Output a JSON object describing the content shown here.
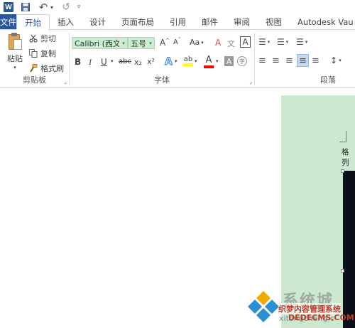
{
  "quick_access": {
    "app_icon_letter": "W",
    "save_glyph": "💾",
    "undo_glyph": "↶",
    "undo_dd": "▾",
    "redo_glyph": "↺",
    "customize_glyph": "▿"
  },
  "tabs": [
    {
      "label": "文件"
    },
    {
      "label": "开始"
    },
    {
      "label": "插入"
    },
    {
      "label": "设计"
    },
    {
      "label": "页面布局"
    },
    {
      "label": "引用"
    },
    {
      "label": "邮件"
    },
    {
      "label": "审阅"
    },
    {
      "label": "视图"
    },
    {
      "label": "Autodesk Vau"
    }
  ],
  "clipboard": {
    "paste_label": "粘贴",
    "paste_dd": "▾",
    "cut_label": "剪切",
    "copy_label": "复制",
    "format_painter_label": "格式刷",
    "group_label": "剪贴板",
    "launcher": "⌟"
  },
  "font": {
    "font_name": "Calibri (西文正",
    "font_size": "五号",
    "dd": "▾",
    "grow_glyph": "A",
    "grow_sup": "^",
    "shrink_glyph": "A",
    "shrink_sup": "ˇ",
    "case_glyph": "Aa",
    "clear_glyph": "A",
    "phonetic_glyph": "文",
    "charborder_glyph": "A",
    "bold": "B",
    "italic": "I",
    "underline": "U",
    "strike": "abc",
    "subscript": "x₂",
    "superscript": "x²",
    "effects_glyph": "A",
    "highlight_glyph": "ab",
    "color_glyph": "A",
    "shading_glyph": "A",
    "enclose_glyph": "字",
    "group_label": "字体",
    "launcher": "⌟"
  },
  "paragraph": {
    "bullets_glyph": "☰",
    "numbering_glyph": "☰",
    "multilevel_glyph": "☰",
    "align_left": "≡",
    "align_center": "≡",
    "align_right": "≡",
    "justify": "≡",
    "distributed": "≡",
    "line_spacing": "↕",
    "group_label": "段落"
  },
  "document": {
    "text_fragment": "格列",
    "para_mark": "↵"
  },
  "watermark": {
    "big_text": "系统城",
    "site_text": "织梦内容管理系统",
    "url_bottom": "xitongcheng.c",
    "url_red": "DEDECMS.COM"
  },
  "colors": {
    "file_tab": "#2b579a",
    "page_background": "#cce8cf",
    "highlight": "#ffff00",
    "font_color": "#ff0000"
  }
}
